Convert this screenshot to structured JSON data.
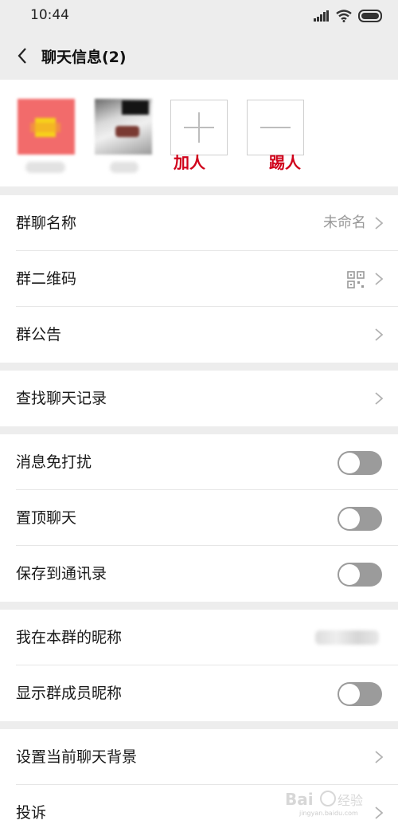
{
  "status_bar": {
    "time": "10:44",
    "icons": [
      "signal-icon",
      "wifi-icon",
      "battery-icon"
    ]
  },
  "nav": {
    "title": "聊天信息(2)"
  },
  "members": {
    "avatars": [
      "red-yellow-avatar",
      "photo-avatar"
    ],
    "add_label": "加人",
    "kick_label": "踢人"
  },
  "settings": {
    "group_name_label": "群聊名称",
    "group_name_value": "未命名",
    "qr_label": "群二维码",
    "notice_label": "群公告",
    "search_history_label": "查找聊天记录",
    "mute_label": "消息免打扰",
    "mute_on": false,
    "sticky_label": "置顶聊天",
    "sticky_on": false,
    "save_contacts_label": "保存到通讯录",
    "save_contacts_on": false,
    "my_nickname_label": "我在本群的昵称",
    "show_nicknames_label": "显示群成员昵称",
    "show_nicknames_on": false,
    "background_label": "设置当前聊天背景",
    "complain_label": "投诉"
  },
  "colors": {
    "accent_red": "#d0021b",
    "toggle_off": "#9b9b9b",
    "background": "#ededed"
  }
}
